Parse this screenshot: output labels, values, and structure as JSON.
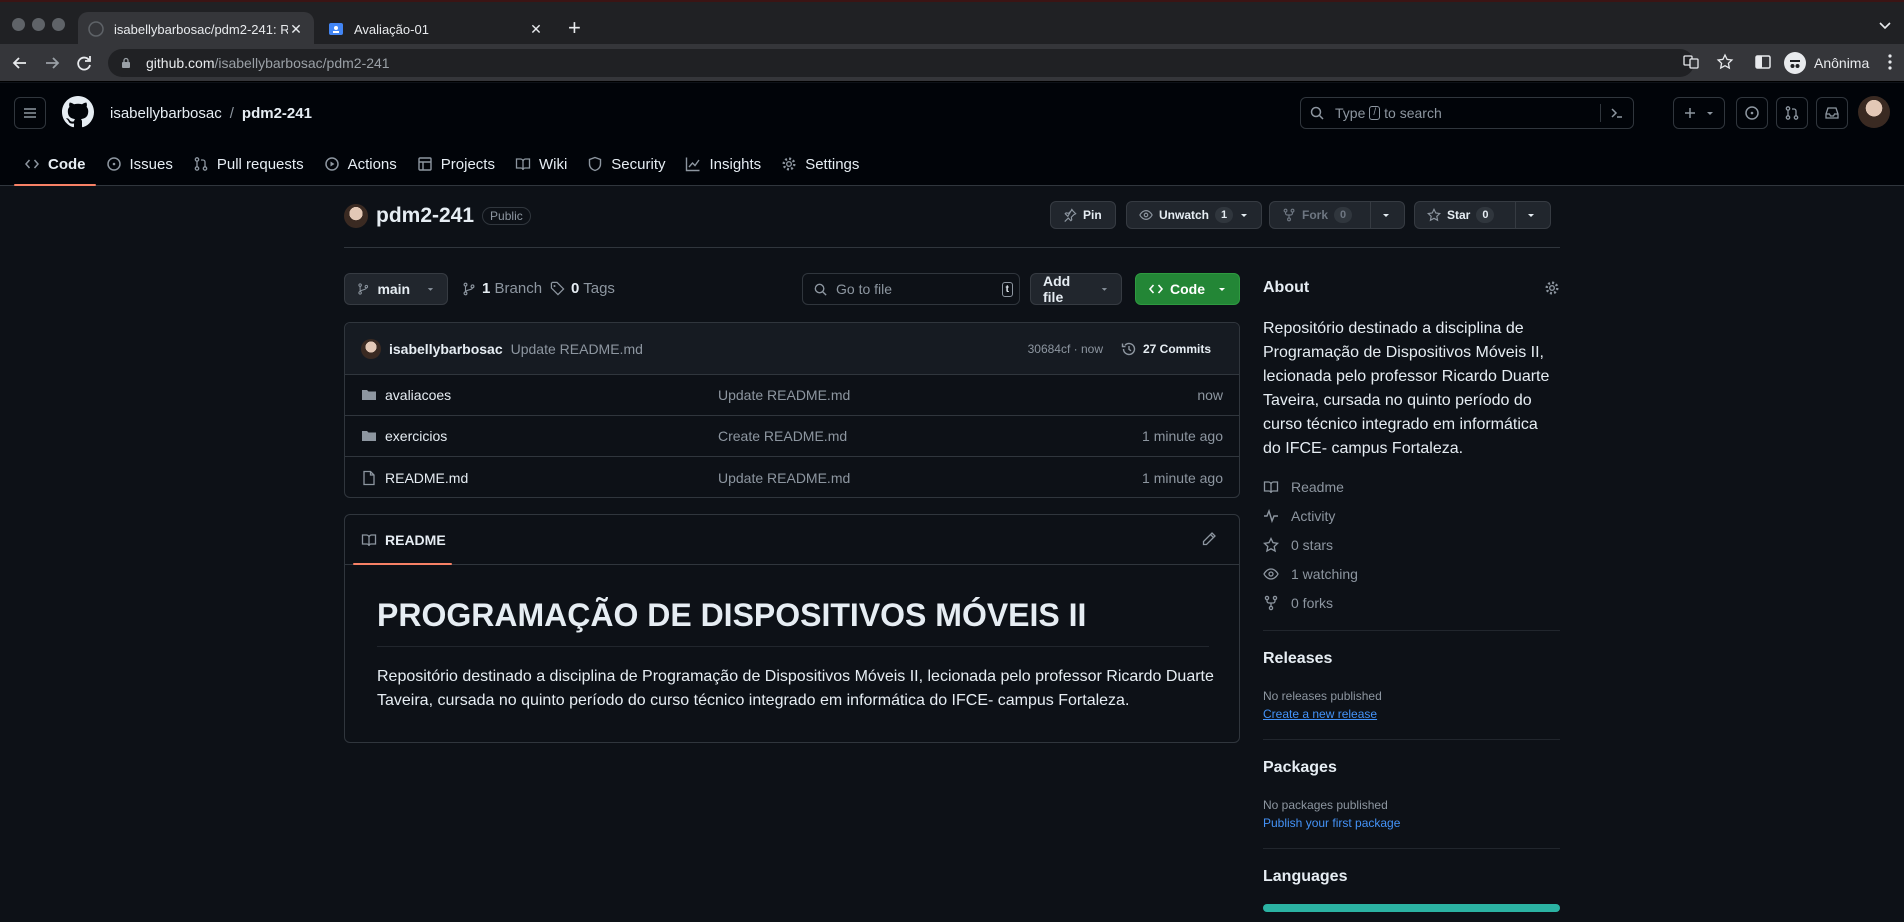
{
  "browser": {
    "tabs": [
      {
        "label": "isabellybarbosac/pdm2-241: R",
        "active": true
      },
      {
        "label": "Avaliação-01",
        "active": false
      }
    ],
    "url_host": "github.com",
    "url_path": "/isabellybarbosac/pdm2-241",
    "profile_label": "Anônima"
  },
  "header": {
    "owner": "isabellybarbosac",
    "separator": "/",
    "repo": "pdm2-241",
    "search_prefix": "Type",
    "search_key": "/",
    "search_suffix": "to search"
  },
  "repo_nav": [
    {
      "label": "Code",
      "icon": "code-icon"
    },
    {
      "label": "Issues",
      "icon": "issue-icon"
    },
    {
      "label": "Pull requests",
      "icon": "pull-request-icon"
    },
    {
      "label": "Actions",
      "icon": "play-icon"
    },
    {
      "label": "Projects",
      "icon": "table-icon"
    },
    {
      "label": "Wiki",
      "icon": "book-icon"
    },
    {
      "label": "Security",
      "icon": "shield-icon"
    },
    {
      "label": "Insights",
      "icon": "graph-icon"
    },
    {
      "label": "Settings",
      "icon": "gear-icon"
    }
  ],
  "repo": {
    "name": "pdm2-241",
    "visibility": "Public",
    "pin_label": "Pin",
    "watch_label": "Unwatch",
    "watch_count": "1",
    "fork_label": "Fork",
    "fork_count": "0",
    "star_label": "Star",
    "star_count": "0"
  },
  "controls": {
    "branch": "main",
    "branches_count": "1",
    "branches_label": "Branch",
    "tags_count": "0",
    "tags_label": "Tags",
    "goto_placeholder": "Go to file",
    "goto_key": "t",
    "add_file_label": "Add file",
    "code_label": "Code"
  },
  "latest_commit": {
    "author": "isabellybarbosac",
    "message": "Update README.md",
    "sha_time": "30684cf · now",
    "commits_label": "27 Commits"
  },
  "files": [
    {
      "type": "folder",
      "name": "avaliacoes",
      "message": "Update README.md",
      "date": "now"
    },
    {
      "type": "folder",
      "name": "exercicios",
      "message": "Create README.md",
      "date": "1 minute ago"
    },
    {
      "type": "file",
      "name": "README.md",
      "message": "Update README.md",
      "date": "1 minute ago"
    }
  ],
  "readme": {
    "tab_label": "README",
    "heading": "PROGRAMAÇÃO DE DISPOSITIVOS MÓVEIS II",
    "body": "Repositório destinado a disciplina de Programação de Dispositivos Móveis II, lecionada pelo professor Ricardo Duarte Taveira, cursada no quinto período do curso técnico integrado em informática do IFCE- campus Fortaleza."
  },
  "sidebar": {
    "about_title": "About",
    "about_text": "Repositório destinado a disciplina de Programação de Dispositivos Móveis II, lecionada pelo professor Ricardo Duarte Taveira, cursada no quinto período do curso técnico integrado em informática do IFCE- campus Fortaleza.",
    "links": [
      {
        "label": "Readme",
        "icon": "book-icon"
      },
      {
        "label": "Activity",
        "icon": "pulse-icon"
      },
      {
        "label": "0 stars",
        "icon": "star-icon"
      },
      {
        "label": "1 watching",
        "icon": "eye-icon"
      },
      {
        "label": "0 forks",
        "icon": "fork-icon"
      }
    ],
    "releases_title": "Releases",
    "releases_empty": "No releases published",
    "releases_link": "Create a new release",
    "packages_title": "Packages",
    "packages_empty": "No packages published",
    "packages_link": "Publish your first package",
    "languages_title": "Languages"
  },
  "colors": {
    "accent_underline": "#f78166",
    "code_button": "#238636",
    "link": "#4493f8",
    "language_bar": "#2bb3a3"
  }
}
